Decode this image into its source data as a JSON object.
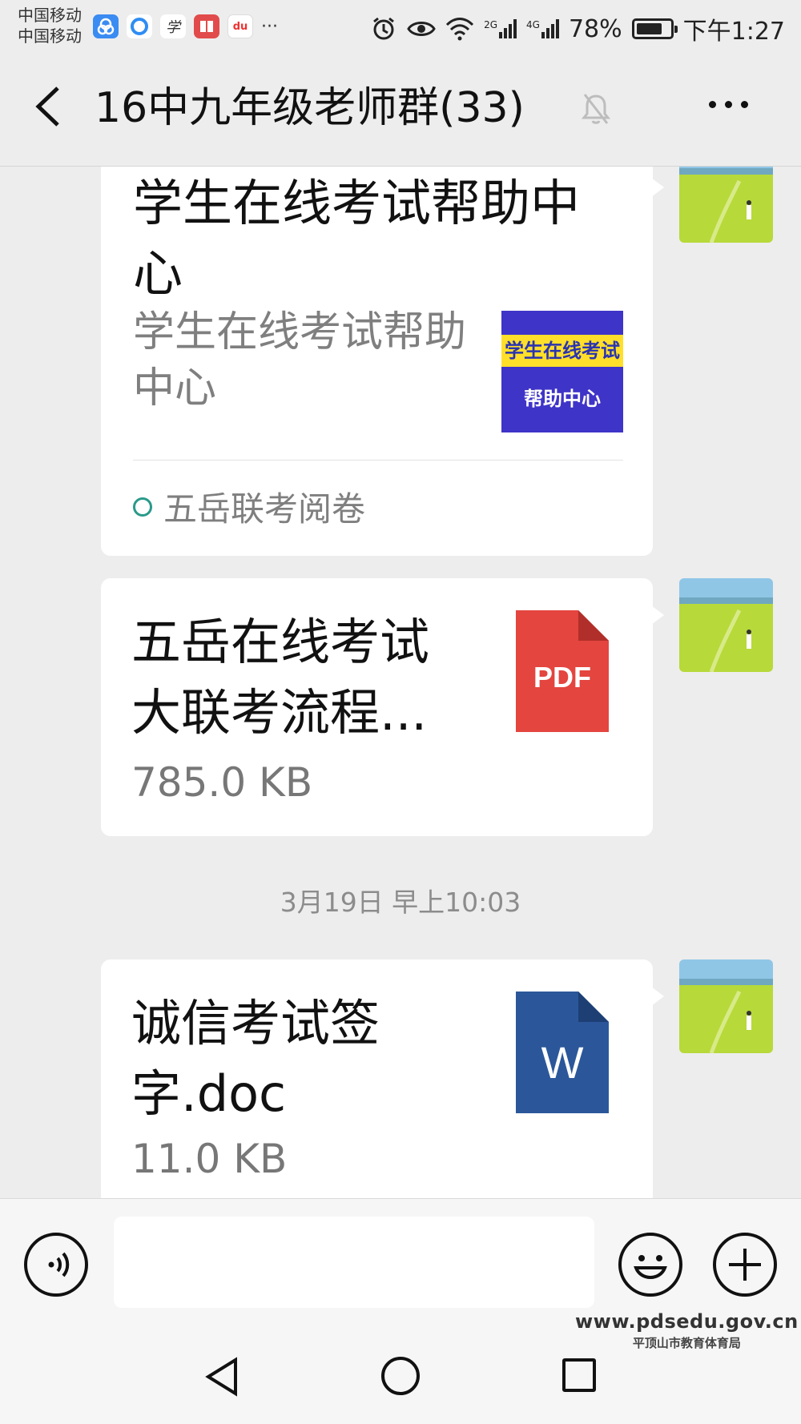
{
  "status_bar": {
    "carrier_1": "中国移动",
    "carrier_2": "中国移动",
    "apps": [
      "baidu-maps-icon",
      "qq-browser-icon",
      "xuexi-icon",
      "reader-icon",
      "du-icon"
    ],
    "overflow": "···",
    "network_1": "2G",
    "network_2": "4G",
    "battery": "78%",
    "battery_level": 0.78,
    "time": "下午1:27"
  },
  "header": {
    "title": "16中九年级老师群(33)",
    "muted": true
  },
  "messages": [
    {
      "type": "link",
      "title": "学生在线考试帮助中心",
      "description": "学生在线考试帮助中心",
      "thumbnail_line1": "学生在线考试",
      "thumbnail_line2": "帮助中心",
      "source": "五岳联考阅卷"
    },
    {
      "type": "file",
      "name": "五岳在线考试大联考流程...",
      "size": "785.0 KB",
      "icon": "pdf-file-icon",
      "icon_label": "PDF",
      "icon_color": "#e4453f"
    },
    {
      "type": "file",
      "name": "诚信考试签字.doc",
      "size": "11.0 KB",
      "icon": "word-file-icon",
      "icon_label": "W",
      "icon_color": "#2b579a"
    }
  ],
  "timestamp": "3月19日 早上10:03",
  "input": {
    "placeholder": ""
  },
  "watermark": {
    "url": "www.pdsedu.gov.cn",
    "org": "平顶山市教育体育局"
  }
}
